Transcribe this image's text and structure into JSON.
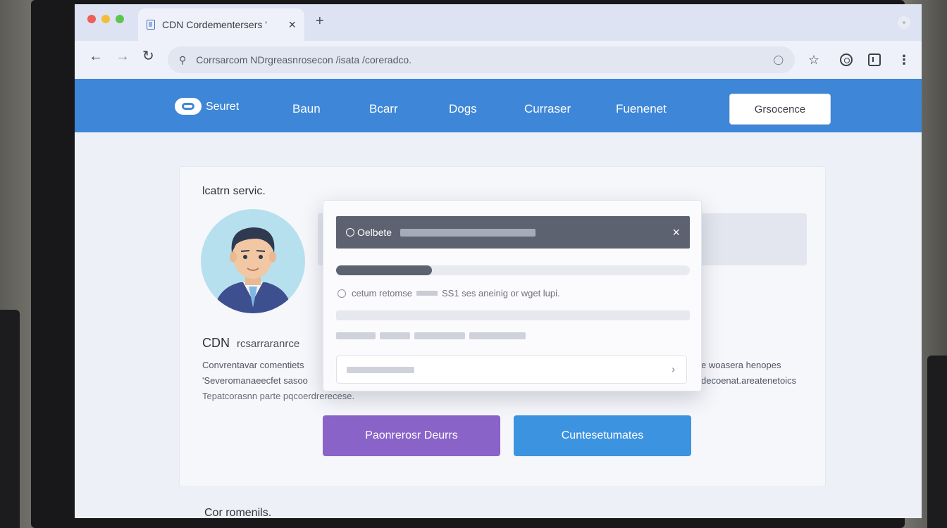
{
  "browser": {
    "tab_title": "CDN Cordementersers '",
    "tab_close": "×",
    "new_tab": "+",
    "url": "Corrsarcom NDrgreasnrosecon /isata /coreradco."
  },
  "site_nav": {
    "brand": "Seuret",
    "links": [
      "Baun",
      "Bcarr",
      "Dogs",
      "Curraser",
      "Fuenenet"
    ],
    "cta": "Grsocence"
  },
  "card": {
    "title": "lcatrn servic.",
    "heading": "CDN",
    "heading_sub": "rcsarraranrce",
    "body_left": [
      "Convrentavar comentiets",
      "'Severomanaeecfet sasoo",
      "Tepatcorasnn parte pqcoerdrerecese."
    ],
    "body_right": [
      "e woasera henopes",
      "decoenat.areatenetoics"
    ],
    "button_primary": "Paonrerosr Deurrs",
    "button_secondary": "Cuntesetumates"
  },
  "dialog": {
    "title": "Oelbete",
    "close": "×",
    "progress": 0.27,
    "status_left": "cetum retomse",
    "status_right": "SS1 ses aneinig or wget lupi.",
    "select_chevron": "›"
  },
  "footer": {
    "text": "Cor romenils."
  },
  "colors": {
    "nav_blue": "#3e86d8",
    "button_purple": "#8a63c9",
    "button_blue": "#3c93e0",
    "dialog_header": "#5c6270"
  }
}
